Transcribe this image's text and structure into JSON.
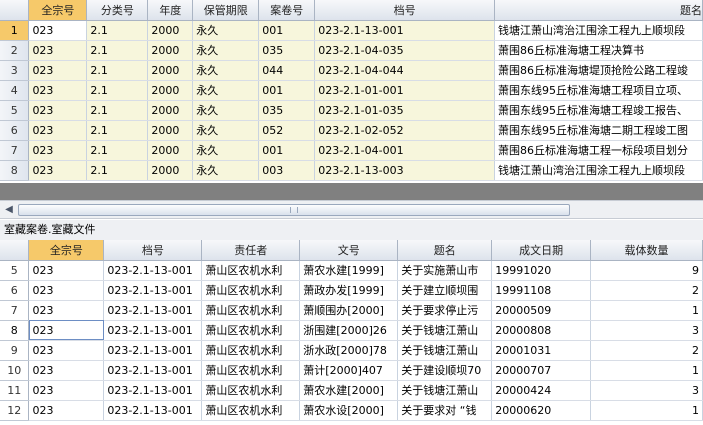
{
  "top_grid": {
    "columns": [
      "全宗号",
      "分类号",
      "年度",
      "保管期限",
      "案卷号",
      "档号",
      "题名"
    ],
    "rows": [
      {
        "n": "1",
        "c": [
          "023",
          "2.1",
          "2000",
          "永久",
          "001",
          "023-2.1-13-001",
          "钱塘江萧山湾治江围涂工程九上顺坝段"
        ]
      },
      {
        "n": "2",
        "c": [
          "023",
          "2.1",
          "2000",
          "永久",
          "035",
          "023-2.1-04-035",
          "萧围86丘标准海塘工程决算书"
        ]
      },
      {
        "n": "3",
        "c": [
          "023",
          "2.1",
          "2000",
          "永久",
          "044",
          "023-2.1-04-044",
          "萧围86丘标准海塘堤顶抢险公路工程竣"
        ]
      },
      {
        "n": "4",
        "c": [
          "023",
          "2.1",
          "2000",
          "永久",
          "001",
          "023-2.1-01-001",
          "萧围东线95丘标准海塘工程项目立项、"
        ]
      },
      {
        "n": "5",
        "c": [
          "023",
          "2.1",
          "2000",
          "永久",
          "035",
          "023-2.1-01-035",
          "萧围东线95丘标准海塘工程竣工报告、"
        ]
      },
      {
        "n": "6",
        "c": [
          "023",
          "2.1",
          "2000",
          "永久",
          "052",
          "023-2.1-02-052",
          "萧围东线95丘标准海塘二期工程竣工图"
        ]
      },
      {
        "n": "7",
        "c": [
          "023",
          "2.1",
          "2000",
          "永久",
          "001",
          "023-2.1-04-001",
          "萧围86丘标准海塘工程一标段项目划分"
        ]
      },
      {
        "n": "8",
        "c": [
          "023",
          "2.1",
          "2000",
          "永久",
          "003",
          "023-2.1-13-003",
          "钱塘江萧山湾治江围涂工程九上顺坝段"
        ]
      }
    ]
  },
  "caption": "室藏案卷.室藏文件",
  "bottom_grid": {
    "columns": [
      "全宗号",
      "档号",
      "责任者",
      "文号",
      "题名",
      "成文日期",
      "载体数量"
    ],
    "rows": [
      {
        "n": "5",
        "c": [
          "023",
          "023-2.1-13-001",
          "萧山区农机水利",
          "萧农水建[1999]",
          "关于实施萧山市",
          "19991020",
          "9"
        ]
      },
      {
        "n": "6",
        "c": [
          "023",
          "023-2.1-13-001",
          "萧山区农机水利",
          "萧政办发[1999]",
          "关于建立顺坝围",
          "19991108",
          "2"
        ]
      },
      {
        "n": "7",
        "c": [
          "023",
          "023-2.1-13-001",
          "萧山区农机水利",
          "萧顺围办[2000]",
          "关于要求停止污",
          "20000509",
          "1"
        ]
      },
      {
        "n": "8",
        "c": [
          "023",
          "023-2.1-13-001",
          "萧山区农机水利",
          "浙围建[2000]26",
          "关于钱塘江萧山",
          "20000808",
          "3"
        ]
      },
      {
        "n": "9",
        "c": [
          "023",
          "023-2.1-13-001",
          "萧山区农机水利",
          "浙水政[2000]78",
          "关于钱塘江萧山",
          "20001031",
          "2"
        ]
      },
      {
        "n": "10",
        "c": [
          "023",
          "023-2.1-13-001",
          "萧山区农机水利",
          "萧计[2000]407",
          "关于建设顺坝70",
          "20000707",
          "1"
        ]
      },
      {
        "n": "11",
        "c": [
          "023",
          "023-2.1-13-001",
          "萧山区农机水利",
          "萧农水建[2000]",
          "关于钱塘江萧山",
          "20000424",
          "3"
        ]
      },
      {
        "n": "12",
        "c": [
          "023",
          "023-2.1-13-001",
          "萧山区农机水利",
          "萧农水设[2000]",
          "关于要求对 “钱",
          "20000620",
          "1"
        ]
      }
    ]
  },
  "colors": {
    "header_active": "#f6c96a",
    "row_tint": "#f7f6dc",
    "gap": "#808080"
  }
}
